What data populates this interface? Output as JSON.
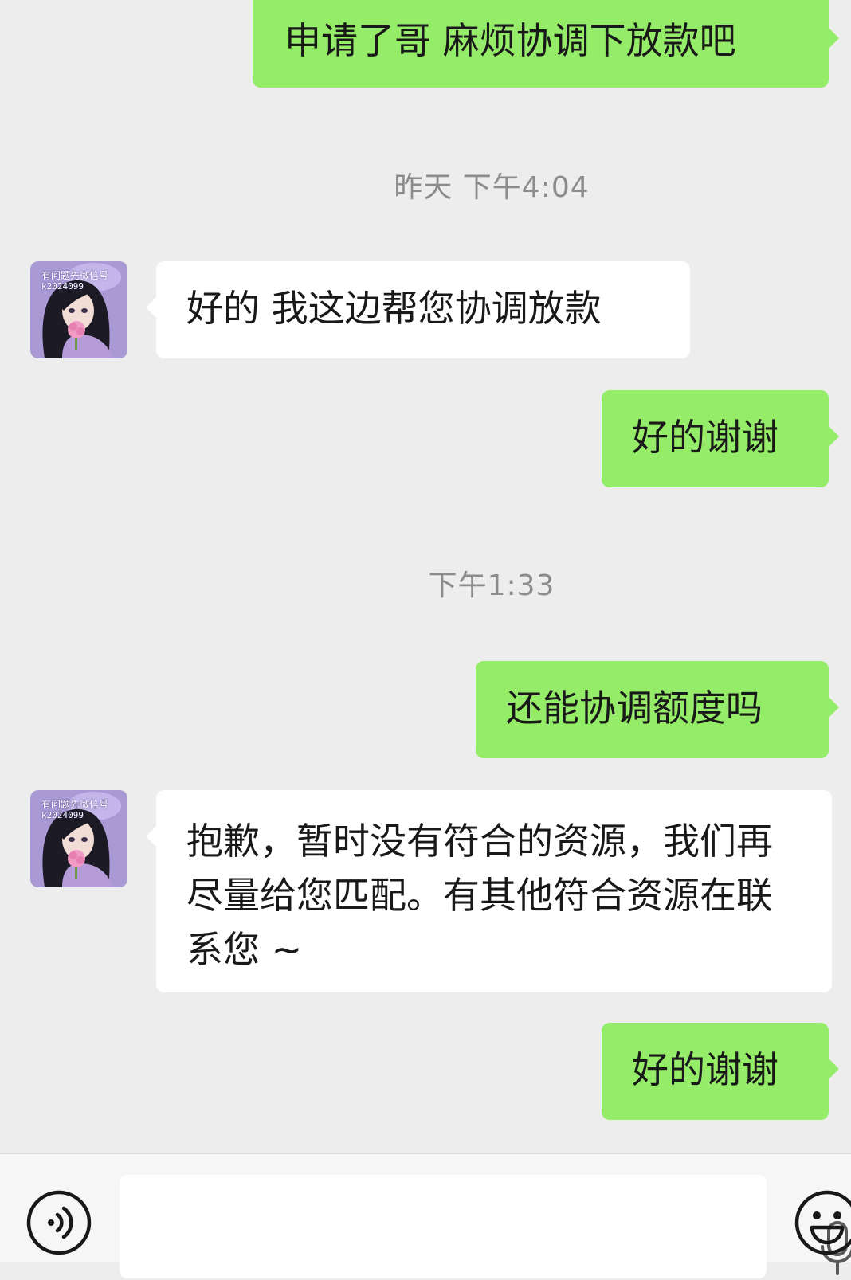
{
  "messages": [
    {
      "id": "m1",
      "side": "me",
      "text": "申请了哥 麻烦协调下放款吧"
    },
    {
      "id": "t1",
      "type": "timestamp",
      "text": "昨天 下午4:04"
    },
    {
      "id": "m2",
      "side": "them",
      "text": "好的 我这边帮您协调放款"
    },
    {
      "id": "m3",
      "side": "me",
      "text": "好的谢谢"
    },
    {
      "id": "t2",
      "type": "timestamp",
      "text": "下午1:33"
    },
    {
      "id": "m4",
      "side": "me",
      "text": "还能协调额度吗"
    },
    {
      "id": "m5",
      "side": "them",
      "text": "抱歉，暂时没有符合的资源，我们再尽量给您匹配。有其他符合资源在联系您 ~"
    },
    {
      "id": "m6",
      "side": "me",
      "text": "好的谢谢"
    }
  ],
  "avatar": {
    "caption_line1": "有问题先微信号",
    "caption_line2": "k2024099",
    "colors": {
      "bg": "#a99ad6",
      "hair": "#1c1a24",
      "skin": "#f2dcd6",
      "shirt": "#b59cd8",
      "flower": "#f09ac4"
    }
  },
  "input_bar": {
    "voice_icon": "voice-mode-icon",
    "mic_icon": "microphone-icon",
    "emoji_icon": "emoji-icon"
  },
  "colors": {
    "background": "#ededed",
    "my_bubble": "#95ec69",
    "their_bubble": "#ffffff",
    "timestamp_text": "#8c8c8c"
  }
}
